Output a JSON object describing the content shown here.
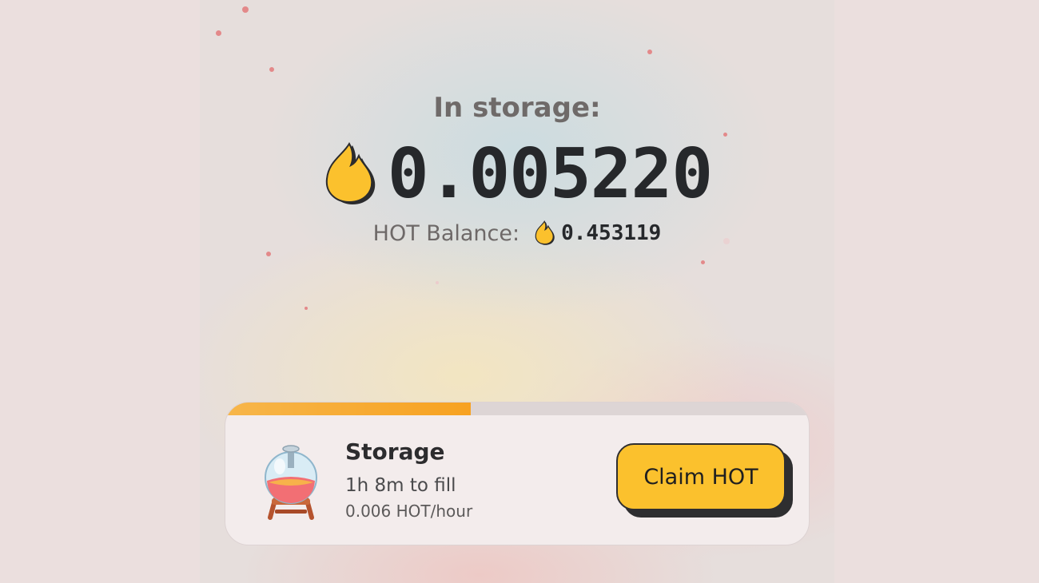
{
  "storage_header": {
    "label": "In storage:",
    "amount": "0.005220",
    "icon": "fire-icon"
  },
  "balance": {
    "label": "HOT Balance:",
    "value": "0.453119",
    "icon": "fire-icon"
  },
  "storage_card": {
    "icon": "storage-flask-icon",
    "title": "Storage",
    "time_to_fill": "1h 8m to fill",
    "rate": "0.006 HOT/hour",
    "progress_fraction": 0.42
  },
  "claim_button": {
    "label": "Claim HOT"
  },
  "colors": {
    "accent_yellow": "#fbc12d",
    "progress_orange": "#f7a221",
    "text_dark": "#26282b"
  }
}
